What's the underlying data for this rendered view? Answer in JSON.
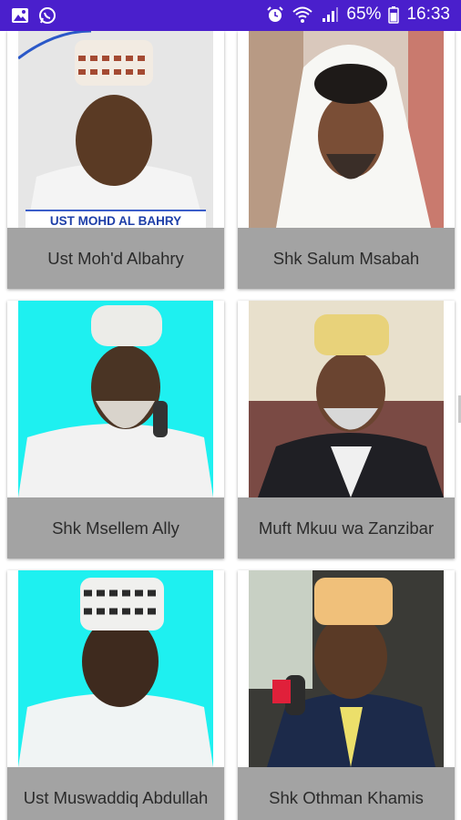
{
  "status_bar": {
    "left_icons": [
      "image-icon",
      "whatsapp-icon"
    ],
    "right_icons": [
      "alarm-icon",
      "wifi-icon",
      "signal-icon",
      "battery-icon"
    ],
    "battery": "65%",
    "time": "16:33",
    "background": "#4a1fcc"
  },
  "cards": [
    {
      "name": "Ust Moh'd Albahry",
      "banner": "UST MOHD AL BAHRY"
    },
    {
      "name": "Shk Salum Msabah"
    },
    {
      "name": "Shk Msellem Ally"
    },
    {
      "name": "Muft Mkuu wa Zanzibar"
    },
    {
      "name": "Ust Muswaddiq Abdullah"
    },
    {
      "name": "Shk Othman Khamis"
    }
  ]
}
